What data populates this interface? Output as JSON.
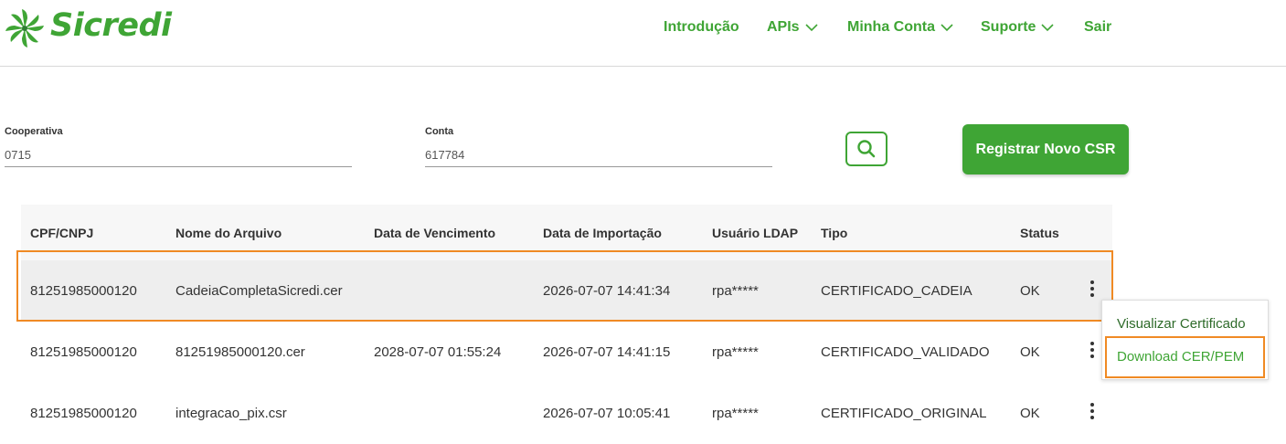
{
  "header": {
    "brand": "Sicredi",
    "nav": [
      {
        "label": "Introdução",
        "has_chevron": false
      },
      {
        "label": "APIs",
        "has_chevron": true
      },
      {
        "label": "Minha Conta",
        "has_chevron": true
      },
      {
        "label": "Suporte",
        "has_chevron": true
      },
      {
        "label": "Sair",
        "has_chevron": false
      }
    ]
  },
  "filters": {
    "cooperativa": {
      "label": "Cooperativa",
      "value": "0715"
    },
    "conta": {
      "label": "Conta",
      "value": "617784"
    },
    "search_icon": "search-icon",
    "register_label": "Registrar Novo CSR"
  },
  "table": {
    "columns": [
      "CPF/CNPJ",
      "Nome do Arquivo",
      "Data de Vencimento",
      "Data de Importação",
      "Usuário LDAP",
      "Tipo",
      "Status"
    ],
    "rows": [
      {
        "cpf": "81251985000120",
        "arquivo": "CadeiaCompletaSicredi.cer",
        "vencimento": "",
        "importacao": "2026-07-07 14:41:34",
        "usuario": "rpa*****",
        "tipo": "CERTIFICADO_CADEIA",
        "status": "OK"
      },
      {
        "cpf": "81251985000120",
        "arquivo": "81251985000120.cer",
        "vencimento": "2028-07-07 01:55:24",
        "importacao": "2026-07-07 14:41:15",
        "usuario": "rpa*****",
        "tipo": "CERTIFICADO_VALIDADO",
        "status": "OK"
      },
      {
        "cpf": "81251985000120",
        "arquivo": "integracao_pix.csr",
        "vencimento": "",
        "importacao": "2026-07-07 10:05:41",
        "usuario": "rpa*****",
        "tipo": "CERTIFICADO_ORIGINAL",
        "status": "OK"
      }
    ]
  },
  "menu": {
    "items": [
      "Visualizar Certificado",
      "Download CER/PEM"
    ]
  },
  "colors": {
    "brand_green": "#3fa535",
    "highlight_orange": "#f08a24"
  }
}
